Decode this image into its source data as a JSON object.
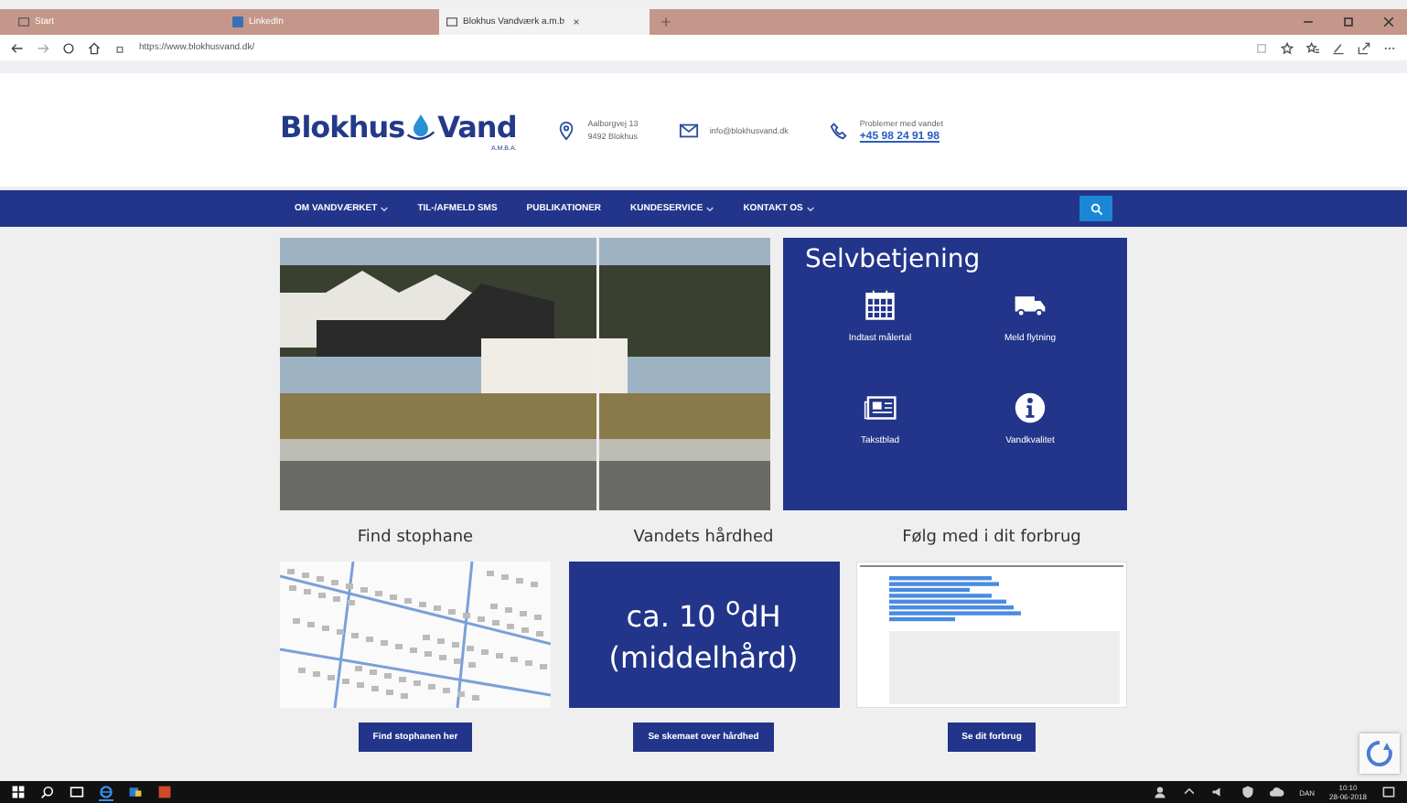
{
  "browser": {
    "tabs": [
      {
        "label": "Start",
        "selected": false,
        "kind": "start"
      },
      {
        "label": "LinkedIn",
        "selected": false,
        "kind": "linkedin"
      },
      {
        "label": "Blokhus Vandværk a.m.b",
        "selected": true,
        "kind": "page"
      }
    ],
    "url": "https://www.blokhusvand.dk/"
  },
  "header": {
    "logo": {
      "word_1": "Blokhus",
      "word_2": "Vand",
      "suffix": "A.M.B.A."
    },
    "address": [
      "Aalborgvej 13",
      "9492 Blokhus"
    ],
    "email": "info@blokhusvand.dk",
    "phone_label": "Problemer med vandet",
    "phone": "+45 98 24 91 98"
  },
  "nav": {
    "items": [
      {
        "label": "OM VANDVÆRKET",
        "dropdown": true
      },
      {
        "label": "TIL-/AFMELD SMS",
        "dropdown": false
      },
      {
        "label": "PUBLIKATIONER",
        "dropdown": false
      },
      {
        "label": "KUNDESERVICE",
        "dropdown": true
      },
      {
        "label": "KONTAKT OS",
        "dropdown": true
      }
    ]
  },
  "selfservice": {
    "title": "Selvbetjening",
    "tiles": [
      {
        "label": "Indtast målertal",
        "kind": "calendar"
      },
      {
        "label": "Meld flytning",
        "kind": "truck"
      },
      {
        "label": "Takstblad",
        "kind": "newspaper"
      },
      {
        "label": "Vandkvalitet",
        "kind": "info"
      }
    ]
  },
  "sections": [
    {
      "title": "Find stophane",
      "kind": "map",
      "button": "Find stophanen her"
    },
    {
      "title": "Vandets hårdhed",
      "kind": "text",
      "lines": [
        "ca. 10 $^{o}$dH",
        "(middelhård)"
      ],
      "button": "Se skemaet over hårdhed"
    },
    {
      "title": "Følg med i dit forbrug",
      "kind": "chart",
      "button": "Se dit forbrug"
    }
  ],
  "taskbar": {
    "language": "DAN",
    "time": "10:10",
    "date": "28-06-2018"
  }
}
